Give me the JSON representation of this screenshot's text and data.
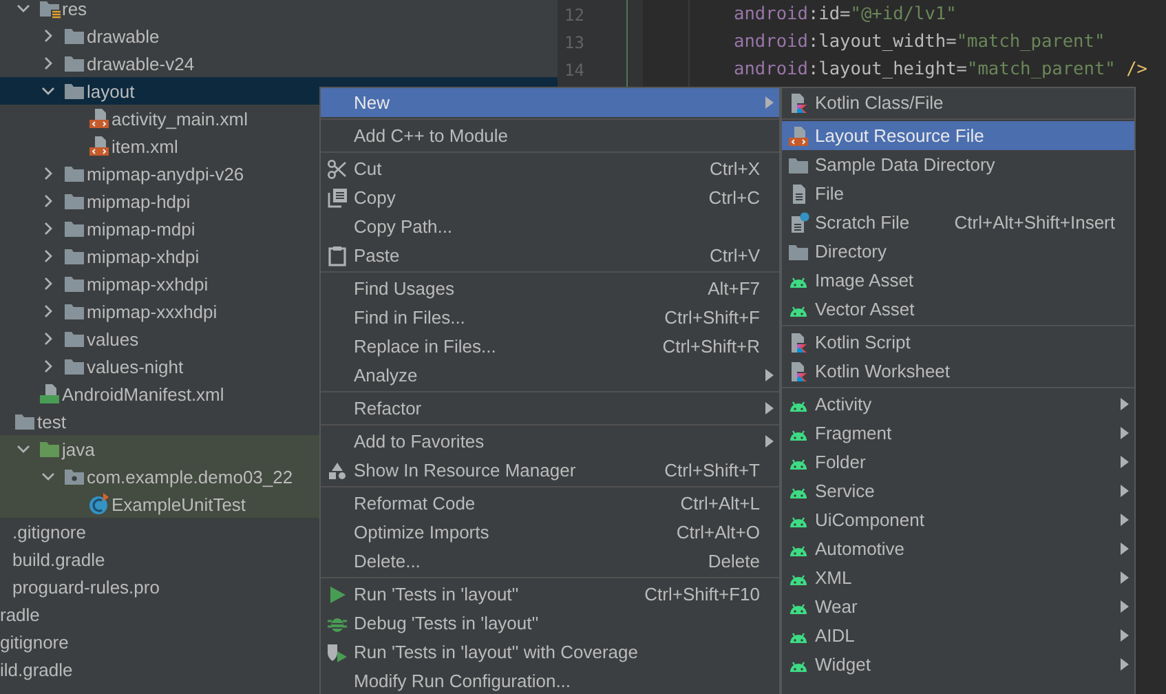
{
  "tree": [
    {
      "children": [
        {
          "children": [
            {
              "children": [
                {
                  "label": "res",
                  "kind": "res-folder",
                  "expanded": true,
                  "selected": false,
                  "highlighted": false,
                  "children": [
                    {
                      "label": "drawable",
                      "kind": "folder",
                      "expanded": false,
                      "selected": false,
                      "highlighted": false
                    },
                    {
                      "label": "drawable-v24",
                      "kind": "folder",
                      "expanded": false,
                      "selected": false,
                      "highlighted": false
                    },
                    {
                      "label": "layout",
                      "kind": "folder",
                      "expanded": true,
                      "selected": true,
                      "highlighted": false,
                      "children": [
                        {
                          "label": "activity_main.xml",
                          "kind": "layout-file",
                          "selected": false,
                          "highlighted": false
                        },
                        {
                          "label": "item.xml",
                          "kind": "layout-file",
                          "selected": false,
                          "highlighted": false
                        }
                      ]
                    },
                    {
                      "label": "mipmap-anydpi-v26",
                      "kind": "folder",
                      "expanded": false,
                      "selected": false,
                      "highlighted": false
                    },
                    {
                      "label": "mipmap-hdpi",
                      "kind": "folder",
                      "expanded": false,
                      "selected": false,
                      "highlighted": false
                    },
                    {
                      "label": "mipmap-mdpi",
                      "kind": "folder",
                      "expanded": false,
                      "selected": false,
                      "highlighted": false
                    },
                    {
                      "label": "mipmap-xhdpi",
                      "kind": "folder",
                      "expanded": false,
                      "selected": false,
                      "highlighted": false
                    },
                    {
                      "label": "mipmap-xxhdpi",
                      "kind": "folder",
                      "expanded": false,
                      "selected": false,
                      "highlighted": false
                    },
                    {
                      "label": "mipmap-xxxhdpi",
                      "kind": "folder",
                      "expanded": false,
                      "selected": false,
                      "highlighted": false
                    },
                    {
                      "label": "values",
                      "kind": "folder",
                      "expanded": false,
                      "selected": false,
                      "highlighted": false
                    },
                    {
                      "label": "values-night",
                      "kind": "folder",
                      "expanded": false,
                      "selected": false,
                      "highlighted": false
                    }
                  ]
                },
                {
                  "label": "AndroidManifest.xml",
                  "kind": "manifest",
                  "selected": false,
                  "highlighted": false
                }
              ]
            },
            {
              "label": "test",
              "kind": "folder",
              "selected": false,
              "highlighted": false,
              "children": [
                {
                  "label": "java",
                  "kind": "source-folder",
                  "expanded": true,
                  "selected": false,
                  "highlighted": true,
                  "children": [
                    {
                      "label": "com.example.demo03_22",
                      "kind": "package",
                      "expanded": true,
                      "selected": false,
                      "highlighted": true,
                      "children": [
                        {
                          "label": "ExampleUnitTest",
                          "kind": "test-class",
                          "selected": false,
                          "highlighted": true
                        }
                      ]
                    }
                  ]
                }
              ]
            }
          ]
        },
        {
          "label": ".gitignore",
          "selected": false,
          "highlighted": false
        },
        {
          "label": "build.gradle",
          "selected": false,
          "highlighted": false
        },
        {
          "label": "proguard-rules.pro",
          "selected": false,
          "highlighted": false
        }
      ]
    },
    {
      "label": "radle",
      "selected": false,
      "highlighted": false
    },
    {
      "label": "gitignore",
      "selected": false,
      "highlighted": false
    },
    {
      "label": "ild.gradle",
      "selected": false,
      "highlighted": false
    }
  ],
  "editor": {
    "lines": [
      {
        "number": "12",
        "tokens": [
          {
            "kind": "ns",
            "text": "android"
          },
          {
            "kind": "attr",
            "text": ":id="
          },
          {
            "kind": "string",
            "text": "\"@+id/lv1\""
          }
        ]
      },
      {
        "number": "13",
        "tokens": [
          {
            "kind": "ns",
            "text": "android"
          },
          {
            "kind": "attr",
            "text": ":layout_width="
          },
          {
            "kind": "string",
            "text": "\"match_parent\""
          }
        ]
      },
      {
        "number": "14",
        "tokens": [
          {
            "kind": "ns",
            "text": "android"
          },
          {
            "kind": "attr",
            "text": ":layout_height="
          },
          {
            "kind": "string",
            "text": "\"match_parent\""
          },
          {
            "kind": "tag",
            "text": " />"
          }
        ]
      }
    ]
  },
  "context_menu": {
    "items": [
      {
        "kind": "item",
        "label": "New",
        "selected": true,
        "submenu": true
      },
      {
        "kind": "separator"
      },
      {
        "kind": "item",
        "label": "Add C++ to Module",
        "selected": false,
        "submenu": false
      },
      {
        "kind": "separator"
      },
      {
        "kind": "item",
        "label": "Cut",
        "shortcut": "Ctrl+X",
        "selected": false,
        "submenu": false
      },
      {
        "kind": "item",
        "label": "Copy",
        "shortcut": "Ctrl+C",
        "selected": false,
        "submenu": false
      },
      {
        "kind": "item",
        "label": "Copy Path...",
        "selected": false,
        "submenu": false
      },
      {
        "kind": "item",
        "label": "Paste",
        "shortcut": "Ctrl+V",
        "selected": false,
        "submenu": false
      },
      {
        "kind": "separator"
      },
      {
        "kind": "item",
        "label": "Find Usages",
        "shortcut": "Alt+F7",
        "selected": false,
        "submenu": false
      },
      {
        "kind": "item",
        "label": "Find in Files...",
        "shortcut": "Ctrl+Shift+F",
        "selected": false,
        "submenu": false
      },
      {
        "kind": "item",
        "label": "Replace in Files...",
        "shortcut": "Ctrl+Shift+R",
        "selected": false,
        "submenu": false
      },
      {
        "kind": "item",
        "label": "Analyze",
        "selected": false,
        "submenu": true
      },
      {
        "kind": "separator"
      },
      {
        "kind": "item",
        "label": "Refactor",
        "selected": false,
        "submenu": true
      },
      {
        "kind": "separator"
      },
      {
        "kind": "item",
        "label": "Add to Favorites",
        "selected": false,
        "submenu": true
      },
      {
        "kind": "item",
        "label": "Show In Resource Manager",
        "shortcut": "Ctrl+Shift+T",
        "selected": false,
        "submenu": false
      },
      {
        "kind": "separator"
      },
      {
        "kind": "item",
        "label": "Reformat Code",
        "shortcut": "Ctrl+Alt+L",
        "selected": false,
        "submenu": false
      },
      {
        "kind": "item",
        "label": "Optimize Imports",
        "shortcut": "Ctrl+Alt+O",
        "selected": false,
        "submenu": false
      },
      {
        "kind": "item",
        "label": "Delete...",
        "shortcut": "Delete",
        "selected": false,
        "submenu": false
      },
      {
        "kind": "separator"
      },
      {
        "kind": "item",
        "label": "Run 'Tests in 'layout''",
        "shortcut": "Ctrl+Shift+F10",
        "selected": false,
        "submenu": false
      },
      {
        "kind": "item",
        "label": "Debug 'Tests in 'layout''",
        "selected": false,
        "submenu": false
      },
      {
        "kind": "item",
        "label": "Run 'Tests in 'layout'' with Coverage",
        "selected": false,
        "submenu": false
      },
      {
        "kind": "item",
        "label": "Modify Run Configuration...",
        "selected": false,
        "submenu": false
      }
    ]
  },
  "new_submenu": {
    "items": [
      {
        "kind": "item",
        "label": "Kotlin Class/File",
        "selected": false,
        "submenu": false
      },
      {
        "kind": "separator"
      },
      {
        "kind": "item",
        "label": "Layout Resource File",
        "selected": true,
        "submenu": false
      },
      {
        "kind": "item",
        "label": "Sample Data Directory",
        "selected": false,
        "submenu": false
      },
      {
        "kind": "item",
        "label": "File",
        "selected": false,
        "submenu": false
      },
      {
        "kind": "item",
        "label": "Scratch File",
        "shortcut": "Ctrl+Alt+Shift+Insert",
        "selected": false,
        "submenu": false
      },
      {
        "kind": "item",
        "label": "Directory",
        "selected": false,
        "submenu": false
      },
      {
        "kind": "item",
        "label": "Image Asset",
        "selected": false,
        "submenu": false
      },
      {
        "kind": "item",
        "label": "Vector Asset",
        "selected": false,
        "submenu": false
      },
      {
        "kind": "separator"
      },
      {
        "kind": "item",
        "label": "Kotlin Script",
        "selected": false,
        "submenu": false
      },
      {
        "kind": "item",
        "label": "Kotlin Worksheet",
        "selected": false,
        "submenu": false
      },
      {
        "kind": "separator"
      },
      {
        "kind": "item",
        "label": "Activity",
        "selected": false,
        "submenu": true
      },
      {
        "kind": "item",
        "label": "Fragment",
        "selected": false,
        "submenu": true
      },
      {
        "kind": "item",
        "label": "Folder",
        "selected": false,
        "submenu": true
      },
      {
        "kind": "item",
        "label": "Service",
        "selected": false,
        "submenu": true
      },
      {
        "kind": "item",
        "label": "UiComponent",
        "selected": false,
        "submenu": true
      },
      {
        "kind": "item",
        "label": "Automotive",
        "selected": false,
        "submenu": true
      },
      {
        "kind": "item",
        "label": "XML",
        "selected": false,
        "submenu": true
      },
      {
        "kind": "item",
        "label": "Wear",
        "selected": false,
        "submenu": true
      },
      {
        "kind": "item",
        "label": "AIDL",
        "selected": false,
        "submenu": true
      },
      {
        "kind": "item",
        "label": "Widget",
        "selected": false,
        "submenu": true
      }
    ]
  }
}
